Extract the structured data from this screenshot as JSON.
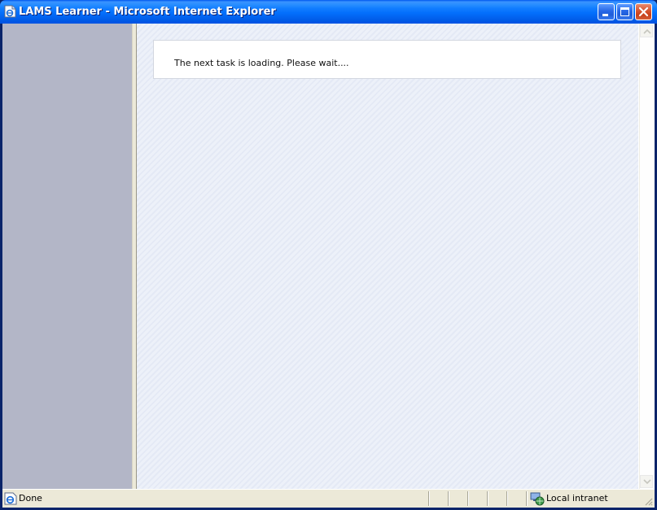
{
  "window": {
    "title": "LAMS Learner - Microsoft Internet Explorer",
    "icons": {
      "app": "ie-page-icon",
      "minimize": "minimize-icon",
      "maximize": "maximize-icon",
      "close": "close-icon"
    }
  },
  "content": {
    "message": "The next task is loading. Please wait...."
  },
  "statusbar": {
    "status": "Done",
    "zone": "Local intranet"
  },
  "colors": {
    "titlebar": "#0054E3",
    "left_frame": "#B3B6C7",
    "content_bg": "#EDF1F9",
    "close_button": "#C7401A"
  }
}
